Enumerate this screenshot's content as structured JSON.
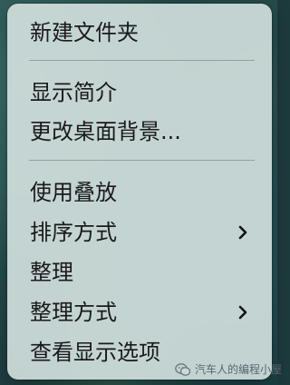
{
  "context_menu": {
    "groups": [
      {
        "items": [
          {
            "label": "新建文件夹",
            "submenu": false
          }
        ]
      },
      {
        "items": [
          {
            "label": "显示简介",
            "submenu": false
          },
          {
            "label": "更改桌面背景...",
            "submenu": false
          }
        ]
      },
      {
        "items": [
          {
            "label": "使用叠放",
            "submenu": false
          },
          {
            "label": "排序方式",
            "submenu": true
          },
          {
            "label": "整理",
            "submenu": false
          },
          {
            "label": "整理方式",
            "submenu": true
          },
          {
            "label": "查看显示选项",
            "submenu": false
          }
        ]
      }
    ],
    "submenu_icon": "chevron-right-icon"
  },
  "watermark": {
    "text": "汽车人的编程小屋",
    "icon": "wechat-logo-icon"
  },
  "colors": {
    "menu_background": "#d0dedc",
    "text": "#1a1a1a",
    "separator": "#5a6464"
  }
}
